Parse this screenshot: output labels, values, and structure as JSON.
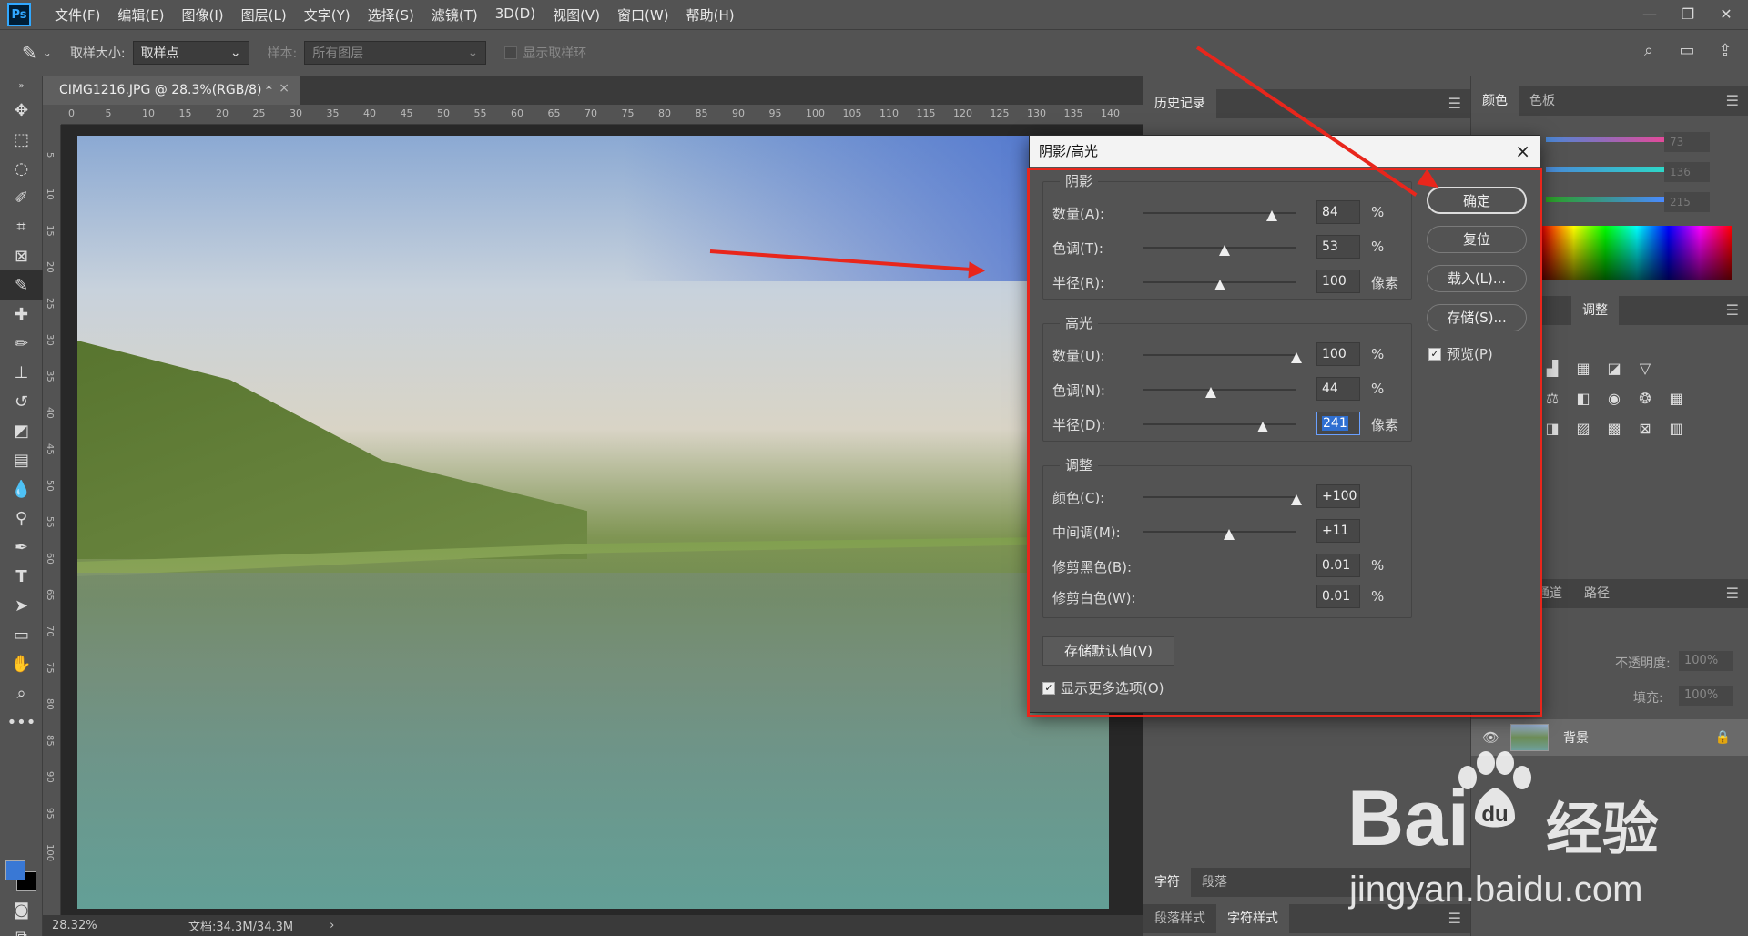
{
  "app": {
    "logo": "Ps"
  },
  "menubar": {
    "items": [
      "文件(F)",
      "编辑(E)",
      "图像(I)",
      "图层(L)",
      "文字(Y)",
      "选择(S)",
      "滤镜(T)",
      "3D(D)",
      "视图(V)",
      "窗口(W)",
      "帮助(H)"
    ],
    "window_controls": [
      "minimize-icon",
      "restore-icon",
      "close-icon"
    ]
  },
  "options_bar": {
    "sample_size_label": "取样大小:",
    "sample_size_value": "取样点",
    "sample_label": "样本:",
    "sample_value": "所有图层",
    "show_ring_label": "显示取样环"
  },
  "document": {
    "tab_title": "CIMG1216.JPG @ 28.3%(RGB/8) *",
    "close": "×",
    "ruler_h": [
      "0",
      "5",
      "10",
      "15",
      "20",
      "25",
      "30",
      "35",
      "40",
      "45",
      "50",
      "55",
      "60",
      "65",
      "70",
      "75",
      "80",
      "85",
      "90",
      "95",
      "100",
      "105",
      "110",
      "115",
      "120",
      "125",
      "130",
      "135",
      "140"
    ],
    "ruler_v": [
      "5",
      "1 0",
      "1 5",
      "2 0",
      "2 5",
      "3 0",
      "3 5",
      "4 0",
      "4 5",
      "5 0",
      "5 5",
      "6 0",
      "6 5",
      "7 0",
      "7 5",
      "8 0",
      "8 5",
      "9 0",
      "9 5",
      "1 0 0"
    ]
  },
  "status": {
    "zoom": "28.32%",
    "doc_info": "文档:34.3M/34.3M",
    "arrow": "›"
  },
  "panels": {
    "history_tab": "历史记录",
    "color_tabs": [
      "颜色",
      "色板"
    ],
    "color_values": [
      "73",
      "136",
      "215"
    ],
    "adjust_tab": "调整",
    "layers_tabs": [
      "通道",
      "路径"
    ],
    "opacity_label": "不透明度:",
    "opacity_value": "100%",
    "fill_label": "填充:",
    "fill_value": "100%",
    "layer_name": "背景",
    "char_tabs": [
      "字符",
      "段落"
    ],
    "style_tabs": [
      "段落样式",
      "字符样式"
    ]
  },
  "dialog": {
    "title": "阴影/高光",
    "close": "×",
    "shadows": {
      "title": "阴影",
      "rows": [
        {
          "label": "数量(A):",
          "value": "84",
          "unit": "%",
          "level": 0.84
        },
        {
          "label": "色调(T):",
          "value": "53",
          "unit": "%",
          "level": 0.53
        },
        {
          "label": "半径(R):",
          "value": "100",
          "unit": "像素",
          "level": 0.5
        }
      ]
    },
    "highlights": {
      "title": "高光",
      "rows": [
        {
          "label": "数量(U):",
          "value": "100",
          "unit": "%",
          "level": 1.0
        },
        {
          "label": "色调(N):",
          "value": "44",
          "unit": "%",
          "level": 0.44
        },
        {
          "label": "半径(D):",
          "value": "241",
          "unit": "像素",
          "level": 0.78
        }
      ]
    },
    "adjustments": {
      "title": "调整",
      "rows": [
        {
          "label": "颜色(C):",
          "value": "+100",
          "unit": "",
          "level": 1.0
        },
        {
          "label": "中间调(M):",
          "value": "+11",
          "unit": "",
          "level": 0.56
        },
        {
          "label": "修剪黑色(B):",
          "value": "0.01",
          "unit": "%"
        },
        {
          "label": "修剪白色(W):",
          "value": "0.01",
          "unit": "%"
        }
      ]
    },
    "buttons": {
      "ok": "确定",
      "reset": "复位",
      "load": "载入(L)...",
      "save": "存储(S)..."
    },
    "preview_label": "预览(P)",
    "save_defaults": "存储默认值(V)",
    "more_options": "显示更多选项(O)"
  },
  "watermark": {
    "bai": "Bai",
    "du": "du",
    "jingyan": "经验",
    "url": "jingyan.baidu.com"
  },
  "colors": {
    "highlight": "#e8261c",
    "foreground": "#3978d5",
    "selection": "#2f6fd1"
  }
}
